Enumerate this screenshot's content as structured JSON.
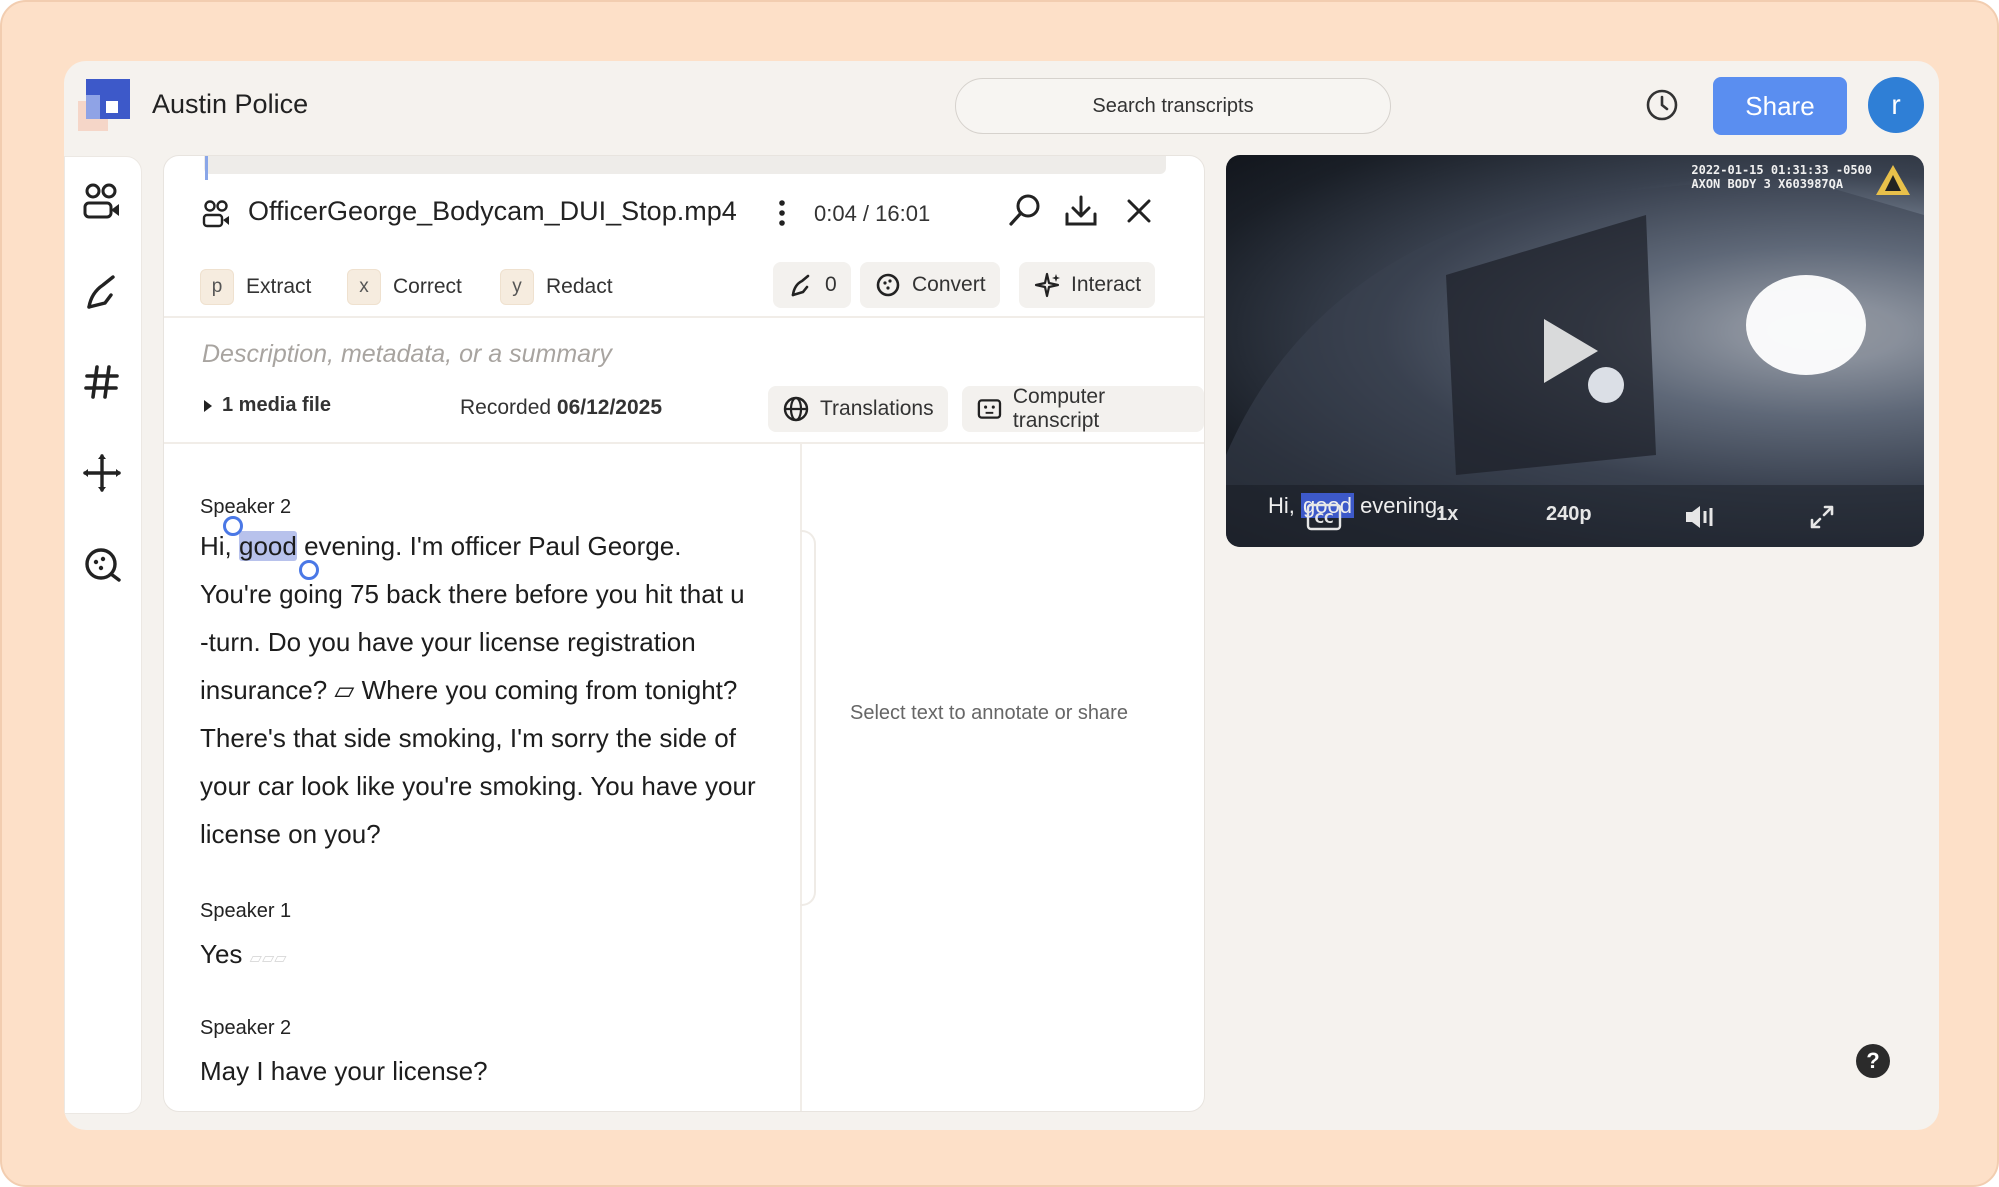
{
  "app": {
    "title": "Austin Police",
    "avatar_letter": "r",
    "share_label": "Share",
    "search_placeholder": "Search transcripts"
  },
  "file": {
    "name": "OfficerGeorge_Bodycam_DUI_Stop.mp4",
    "time": "0:04 / 16:01"
  },
  "actions": {
    "extract": {
      "key": "p",
      "label": "Extract"
    },
    "correct": {
      "key": "x",
      "label": "Correct"
    },
    "redact": {
      "key": "y",
      "label": "Redact"
    },
    "annotation_count": "0",
    "convert": "Convert",
    "interact": "Interact"
  },
  "meta": {
    "description_placeholder": "Description, metadata, or a summary",
    "media_files": "1 media file",
    "recorded_label": "Recorded",
    "recorded_date": "06/12/2025",
    "translations": "Translations",
    "computer_transcript": "Computer transcript"
  },
  "transcript": {
    "segments": [
      {
        "speaker": "Speaker 2",
        "pre": "Hi, ",
        "highlight": "good",
        "post": " evening. I'm officer Paul George. You're going 75 back there before you hit that u -turn. Do you have your license registration insurance? ▱ Where you coming from tonight? There's that side smoking, I'm sorry the side of your car look like you're smoking. You have your license on you?"
      },
      {
        "speaker": "Speaker 1",
        "text": "Yes",
        "trail": "▱▱▱"
      },
      {
        "speaker": "Speaker 2",
        "text": "May I have your license?"
      }
    ],
    "side_note": "Select text to annotate or share"
  },
  "video": {
    "timestamp_line1": "2022-01-15 01:31:33 -0500",
    "timestamp_line2": "AXON BODY 3 X603987QA",
    "caption_pre": "Hi, ",
    "caption_highlight": "good",
    "caption_post": " evening.",
    "speed": "1x",
    "quality": "240p"
  },
  "help_label": "?",
  "colors": {
    "accent": "#5a8ef0",
    "avatar": "#2f7fd6",
    "highlight": "#b8c2ec",
    "frame": "#fde0c8"
  }
}
